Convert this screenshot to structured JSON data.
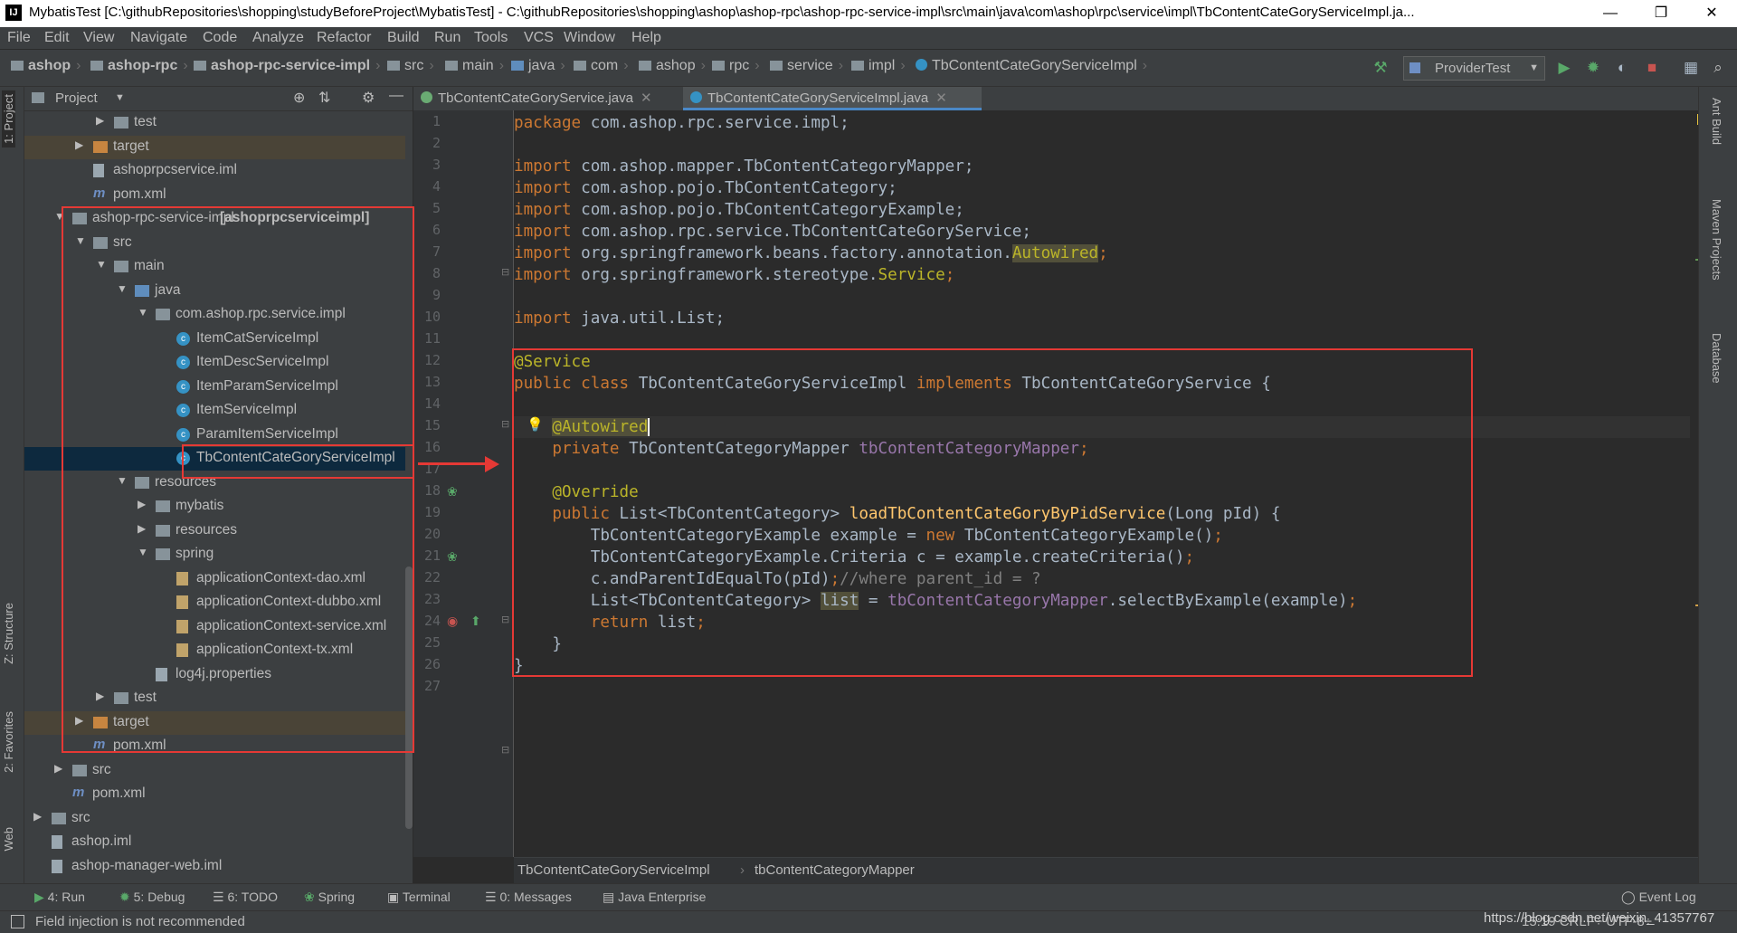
{
  "window": {
    "title": "MybatisTest [C:\\githubRepositories\\shopping\\studyBeforeProject\\MybatisTest] - C:\\githubRepositories\\shopping\\ashop\\ashop-rpc\\ashop-rpc-service-impl\\src\\main\\java\\com\\ashop\\rpc\\service\\impl\\TbContentCateGoryServiceImpl.ja...",
    "minimize": "—",
    "maximize": "❐",
    "close": "✕"
  },
  "menu": [
    "File",
    "Edit",
    "View",
    "Navigate",
    "Code",
    "Analyze",
    "Refactor",
    "Build",
    "Run",
    "Tools",
    "VCS",
    "Window",
    "Help"
  ],
  "nav": {
    "crumbs": [
      "ashop",
      "ashop-rpc",
      "ashop-rpc-service-impl",
      "src",
      "main",
      "java",
      "com",
      "ashop",
      "rpc",
      "service",
      "impl",
      "TbContentCateGoryServiceImpl"
    ],
    "run_config": "ProviderTest"
  },
  "left_tabs": {
    "project": "1: Project",
    "structure": "Z: Structure",
    "favorites": "2: Favorites",
    "web": "Web"
  },
  "right_tabs": {
    "ant": "Ant Build",
    "maven": "Maven Projects",
    "database": "Database"
  },
  "project": {
    "header": "Project",
    "rows": [
      {
        "label": "test",
        "bold": ""
      },
      {
        "label": "target",
        "bold": ""
      },
      {
        "label": "ashoprpcservice.iml",
        "bold": ""
      },
      {
        "label": "pom.xml",
        "bold": ""
      },
      {
        "label": "ashop-rpc-service-impl ",
        "bold": "[ashoprpcserviceimpl]"
      },
      {
        "label": "src",
        "bold": ""
      },
      {
        "label": "main",
        "bold": ""
      },
      {
        "label": "java",
        "bold": ""
      },
      {
        "label": "com.ashop.rpc.service.impl",
        "bold": ""
      },
      {
        "label": "ItemCatServiceImpl",
        "bold": ""
      },
      {
        "label": "ItemDescServiceImpl",
        "bold": ""
      },
      {
        "label": "ItemParamServiceImpl",
        "bold": ""
      },
      {
        "label": "ItemServiceImpl",
        "bold": ""
      },
      {
        "label": "ParamItemServiceImpl",
        "bold": ""
      },
      {
        "label": "TbContentCateGoryServiceImpl",
        "bold": ""
      },
      {
        "label": "resources",
        "bold": ""
      },
      {
        "label": "mybatis",
        "bold": ""
      },
      {
        "label": "resources",
        "bold": ""
      },
      {
        "label": "spring",
        "bold": ""
      },
      {
        "label": "applicationContext-dao.xml",
        "bold": ""
      },
      {
        "label": "applicationContext-dubbo.xml",
        "bold": ""
      },
      {
        "label": "applicationContext-service.xml",
        "bold": ""
      },
      {
        "label": "applicationContext-tx.xml",
        "bold": ""
      },
      {
        "label": "log4j.properties",
        "bold": ""
      },
      {
        "label": "test",
        "bold": ""
      },
      {
        "label": "target",
        "bold": ""
      },
      {
        "label": "pom.xml",
        "bold": ""
      },
      {
        "label": "src",
        "bold": ""
      },
      {
        "label": "pom.xml",
        "bold": ""
      },
      {
        "label": "src",
        "bold": ""
      },
      {
        "label": "ashop.iml",
        "bold": ""
      },
      {
        "label": "ashop-manager-web.iml",
        "bold": ""
      }
    ]
  },
  "editor": {
    "tabs": [
      "TbContentCateGoryService.java",
      "TbContentCateGoryServiceImpl.java"
    ],
    "line_numbers": [
      "1",
      "2",
      "3",
      "4",
      "5",
      "6",
      "7",
      "8",
      "9",
      "10",
      "11",
      "12",
      "13",
      "14",
      "15",
      "16",
      "17",
      "18",
      "19",
      "20",
      "21",
      "22",
      "23",
      "24",
      "25",
      "26",
      "27"
    ],
    "code": {
      "l1a": "package",
      "l1b": " com.ashop.rpc.service.impl;",
      "l3a": "import",
      "l3b": " com.ashop.mapper.TbContentCategoryMapper;",
      "l4a": "import",
      "l4b": " com.ashop.pojo.TbContentCategory;",
      "l5a": "import",
      "l5b": " com.ashop.pojo.TbContentCategoryExample;",
      "l6a": "import",
      "l6b": " com.ashop.rpc.service.TbContentCateGoryService;",
      "l7a": "import",
      "l7b": " org.springframework.beans.factory.annotation.",
      "l7c": "Autowired",
      "l7d": ";",
      "l8a": "import",
      "l8b": " org.springframework.stereotype.",
      "l8c": "Service",
      "l8d": ";",
      "l10a": "import",
      "l10b": " java.util.List;",
      "l12": "@Service",
      "l13a": "public class",
      "l13b": " TbContentCateGoryServiceImpl ",
      "l13c": "implements",
      "l13d": " TbContentCateGoryService {",
      "l15": "@Autowired",
      "l16a": "private",
      "l16b": " TbContentCategoryMapper ",
      "l16c": "tbContentCategoryMapper",
      "l16d": ";",
      "l18": "@Override",
      "l19a": "public",
      "l19b": " List<TbContentCategory> ",
      "l19c": "loadTbContentCateGoryByPidService",
      "l19d": "(Long pId) {",
      "l20a": "TbContentCategoryExample example = ",
      "l20b": "new",
      "l20c": " TbContentCategoryExample()",
      "l20d": ";",
      "l21a": "TbContentCategoryExample.Criteria c = example.createCriteria()",
      "l21b": ";",
      "l22a": "c.andParentIdEqualTo(pId)",
      "l22b": ";",
      "l22c": "//where parent_id = ?",
      "l23a": "List<TbContentCategory> ",
      "l23b": "list",
      "l23c": " = ",
      "l23d": "tbContentCategoryMapper",
      "l23e": ".selectByExample(example)",
      "l23f": ";",
      "l24a": "return",
      "l24b": " list",
      "l24c": ";",
      "l25": "}",
      "l26": "}"
    },
    "breadcrumb": [
      "TbContentCateGoryServiceImpl",
      "tbContentCategoryMapper"
    ]
  },
  "bottom_tools": [
    "4: Run",
    "5: Debug",
    "6: TODO",
    "Spring",
    "Terminal",
    "0: Messages",
    "Java Enterprise"
  ],
  "event_log": "Event Log",
  "status": {
    "message": "Field injection is not recommended",
    "right": "15:19  CRLF÷  UTF-8÷",
    "watermark": "https://blog.csdn.net/weixin_41357767"
  },
  "colors": {
    "annotation_box": "#e53935",
    "keyword": "#cc7832",
    "annotation": "#bbb529",
    "method": "#ffc66d",
    "field": "#9876aa"
  }
}
